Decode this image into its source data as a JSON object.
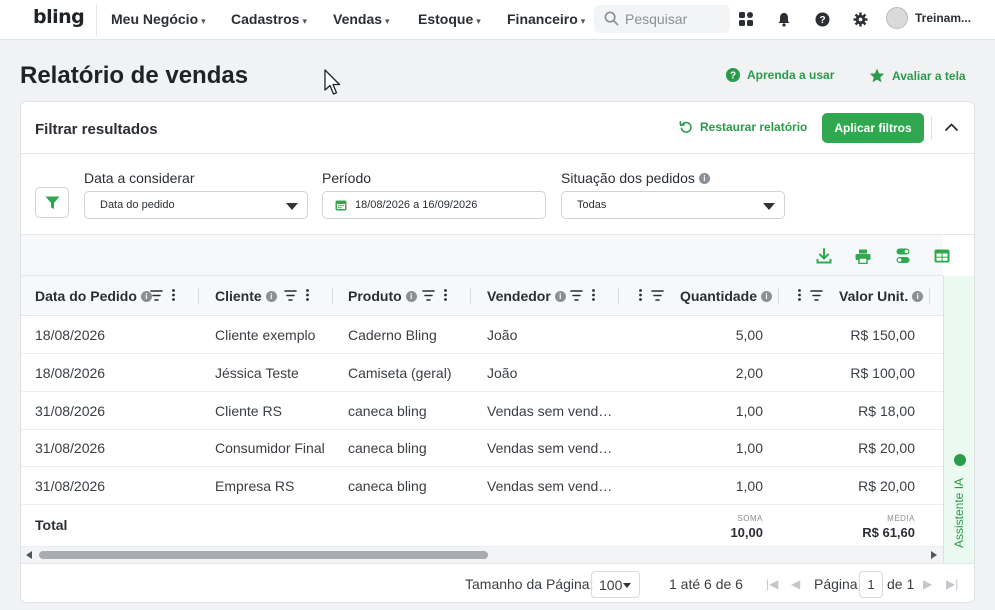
{
  "app": {
    "logo": "bling",
    "user": "Treinam..."
  },
  "nav": {
    "items": [
      {
        "label": "Meu Negócio"
      },
      {
        "label": "Cadastros"
      },
      {
        "label": "Vendas"
      },
      {
        "label": "Estoque"
      },
      {
        "label": "Financeiro"
      }
    ],
    "search_placeholder": "Pesquisar",
    "chevron": "⌄"
  },
  "page": {
    "title": "Relatório de vendas",
    "learn_link": "Aprenda a usar",
    "rate_link": "Avaliar a tela"
  },
  "filters": {
    "title": "Filtrar resultados",
    "restore": "Restaurar relatório",
    "apply": "Aplicar filtros",
    "date_label": "Data a considerar",
    "date_value": "Data do pedido",
    "period_label": "Período",
    "period_value": "18/08/2026 a 16/09/2026",
    "status_label": "Situação dos pedidos",
    "status_value": "Todas"
  },
  "table": {
    "columns": [
      "Data do Pedido",
      "Cliente",
      "Produto",
      "Vendedor",
      "Quantidade",
      "Valor Unit."
    ],
    "rows": [
      [
        "18/08/2026",
        "Cliente exemplo",
        "Caderno Bling",
        "João",
        "5,00",
        "R$ 150,00"
      ],
      [
        "18/08/2026",
        "Jéssica Teste",
        "Camiseta (geral)",
        "João",
        "2,00",
        "R$ 100,00"
      ],
      [
        "31/08/2026",
        "Cliente RS",
        "caneca bling",
        "Vendas sem vend…",
        "1,00",
        "R$ 18,00"
      ],
      [
        "31/08/2026",
        "Consumidor Final",
        "caneca bling",
        "Vendas sem vend…",
        "1,00",
        "R$ 20,00"
      ],
      [
        "31/08/2026",
        "Empresa RS",
        "caneca bling",
        "Vendas sem vend…",
        "1,00",
        "R$ 20,00"
      ]
    ],
    "total_label": "Total",
    "sum_key": "SOMA",
    "sum_value": "10,00",
    "avg_key": "MÉDIA",
    "avg_value": "R$ 61,60"
  },
  "pager": {
    "size_label": "Tamanho da Página:",
    "size_value": "100",
    "range": "1 até 6 de 6",
    "page_label": "Página",
    "page_value": "1",
    "of": "de 1"
  },
  "assistant": {
    "label": "Assistente IA"
  },
  "colors": {
    "accent": "#2fa84f",
    "accent_text": "#2c9a4b"
  }
}
